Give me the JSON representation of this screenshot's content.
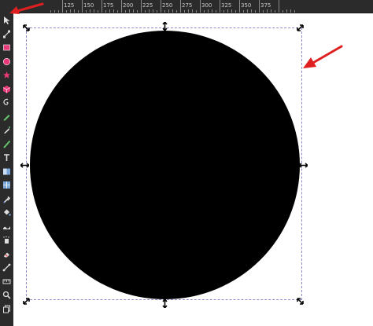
{
  "ruler": {
    "labels": [
      "125",
      "150",
      "175",
      "200",
      "225",
      "250",
      "275",
      "300",
      "325",
      "350",
      "375"
    ]
  },
  "toolbox": {
    "tools": [
      "selector-icon",
      "node-icon",
      "rectangle-icon",
      "ellipse-icon",
      "star-icon",
      "box3d-icon",
      "spiral-icon",
      "pencil-icon",
      "pen-icon",
      "calligraphy-icon",
      "text-icon",
      "gradient-icon",
      "mesh-icon",
      "dropper-icon",
      "paint-bucket-icon",
      "tweak-icon",
      "spray-icon",
      "eraser-icon",
      "connector-icon",
      "measure-icon",
      "zoom-icon",
      "pages-icon"
    ]
  },
  "colors": {
    "shape_fill": "#000000",
    "annotation_arrow": "#e02020",
    "bbox_border": "#8c8cc8",
    "ui_dark": "#2b2b2b"
  }
}
